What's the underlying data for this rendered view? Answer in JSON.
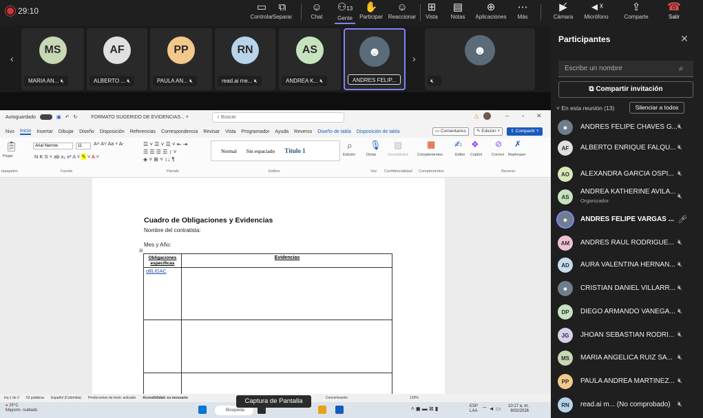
{
  "meeting": {
    "timer": "29:10"
  },
  "toolbar": {
    "buttons": [
      {
        "label": "Controlar",
        "icon": "monitor-icon"
      },
      {
        "label": "Separar",
        "icon": "popout-icon"
      },
      {
        "label": "Chat",
        "icon": "chat-icon"
      },
      {
        "label": "Gente",
        "icon": "people-icon",
        "count": "13"
      },
      {
        "label": "Participar",
        "icon": "raise-hand-icon"
      },
      {
        "label": "Reaccionar",
        "icon": "emoji-icon"
      },
      {
        "label": "Vista",
        "icon": "grid-icon"
      },
      {
        "label": "Notas",
        "icon": "notes-icon"
      },
      {
        "label": "Aplicaciones",
        "icon": "apps-icon"
      },
      {
        "label": "Más",
        "icon": "more-icon"
      },
      {
        "label": "Cámara",
        "icon": "camera-off-icon"
      },
      {
        "label": "Micrófono",
        "icon": "mic-off-icon"
      },
      {
        "label": "Comparte",
        "icon": "share-icon"
      },
      {
        "label": "Salir",
        "icon": "phone-hangup-icon"
      }
    ]
  },
  "video_tiles": [
    {
      "initials": "MS",
      "name": "MARIA AN...",
      "color": "#c7d8b4"
    },
    {
      "initials": "AF",
      "name": "ALBERTO ...",
      "color": "#e0e0e0"
    },
    {
      "initials": "PP",
      "name": "PAULA AN...",
      "color": "#f2c98a"
    },
    {
      "initials": "RN",
      "name": "read.ai me...",
      "color": "#b7d4ea"
    },
    {
      "initials": "AS",
      "name": "ANDREA K...",
      "color": "#c6e3c0"
    },
    {
      "initials": "",
      "name": "ANDRES FELIP...",
      "color": "#5a6b7a"
    },
    {
      "initials": "",
      "name": "",
      "color": "#6f7d8c"
    }
  ],
  "word": {
    "autosave": "Autoguardado",
    "filename": "FORMATO SUGERIDO DE EVIDENCIAS... ˅",
    "search_placeholder": "Buscar",
    "menu": [
      "hivo",
      "Inicio",
      "Insertar",
      "Dibujar",
      "Diseño",
      "Disposición",
      "Referencias",
      "Correspondencia",
      "Revisar",
      "Vista",
      "Programador",
      "Ayuda",
      "Reverso",
      "Diseño de tabla",
      "Disposición de tabla"
    ],
    "comments_btn": "Comentarios",
    "edit_btn": "Edición",
    "share_btn": "Compartir",
    "font_name": "Arial Narrow",
    "font_size": "11",
    "styles": [
      "Normal",
      "Sin espaciado",
      "Título 1"
    ],
    "group_labels": [
      "tapapeles",
      "Fuente",
      "Párrafo",
      "Estilos",
      "Voz",
      "Confidencialidad",
      "Complementos",
      "Reverso"
    ],
    "ribbon_buttons": [
      "Edición",
      "Dictar",
      "Sensibilidad",
      "Complementos",
      "Editor",
      "Copilot",
      "Correct",
      "Rephraser"
    ],
    "pegar": "Pegar",
    "doc_heading": "Cuadro de Obligaciones y Evidencias",
    "doc_line1": "Nombre del contratista:",
    "doc_line2": "Mes y Año:",
    "table_head_1": "Obligaciones específicas",
    "table_head_2": "Evidencias",
    "table_cell": "oBLIGAC",
    "status": [
      "ina 1 de 2",
      "52 palabras",
      "Español (Colombia)",
      "Predicciones de texto: activado",
      "Accesibilidad: es necesario",
      "Concentración",
      "120%"
    ],
    "weather_temp": "25°C",
    "weather_desc": "Mayorm. nublado",
    "taskbar_search": "Búsqueda",
    "lang": "ESP LAA",
    "clock_time": "10:17 a. m.",
    "clock_date": "9/02/2026"
  },
  "tooltip": "Captura de Pantalla",
  "panel": {
    "title": "Participantes",
    "search_placeholder": "Escribe un nombre",
    "invite": "Compartir invitación",
    "section": "En esta reunión (13)",
    "mute_all": "Silenciar a todos",
    "participants": [
      {
        "initials": "",
        "name": "ANDRES FELIPE CHAVES G...",
        "sub": "",
        "color": "#6f7d8c",
        "photo": true,
        "mic": "mic-off-icon"
      },
      {
        "initials": "AF",
        "name": "ALBERTO ENRIQUE FALQU...",
        "sub": "",
        "color": "#e0e0e0",
        "mic": "mic-off-icon"
      },
      {
        "initials": "AO",
        "name": "ALEXANDRA GARCIA OSPI...",
        "sub": "",
        "color": "#d8e8b8",
        "mic": "mic-off-icon"
      },
      {
        "initials": "AS",
        "name": "ANDREA KATHERINE AVILA...",
        "sub": "Organizador",
        "color": "#c6e3c0",
        "mic": "mic-off-icon"
      },
      {
        "initials": "",
        "name": "ANDRES FELIPE VARGAS ...",
        "sub": "",
        "color": "#5a6b7a",
        "photo": true,
        "mic": "mic-on-icon",
        "bold": true
      },
      {
        "initials": "AM",
        "name": "ANDRES RAUL RODRIGUE...",
        "sub": "",
        "color": "#f0c0d4",
        "mic": "mic-off-icon"
      },
      {
        "initials": "AD",
        "name": "AURA VALENTINA HERNAN...",
        "sub": "",
        "color": "#c8dcf0",
        "mic": "mic-off-icon"
      },
      {
        "initials": "",
        "name": "CRISTIAN DANIEL VILLARR...",
        "sub": "",
        "color": "#8a8a8a",
        "photo": true,
        "mic": "mic-off-icon"
      },
      {
        "initials": "DP",
        "name": "DIEGO ARMANDO VANEGA...",
        "sub": "",
        "color": "#c6e3c0",
        "mic": "mic-off-icon"
      },
      {
        "initials": "JG",
        "name": "JHOAN SEBASTIAN RODRI...",
        "sub": "",
        "color": "#d8d0ec",
        "mic": "mic-off-icon"
      },
      {
        "initials": "MS",
        "name": "MARIA ANGELICA RUIZ SA...",
        "sub": "",
        "color": "#c7d8b4",
        "mic": "mic-off-icon"
      },
      {
        "initials": "PP",
        "name": "PAULA ANDREA MARTINEZ...",
        "sub": "",
        "color": "#f2c98a",
        "mic": "mic-off-icon"
      },
      {
        "initials": "RN",
        "name": "read.ai m... (No comprobado)",
        "sub": "",
        "color": "#b7d4ea",
        "mic": "mic-off-icon"
      }
    ]
  }
}
